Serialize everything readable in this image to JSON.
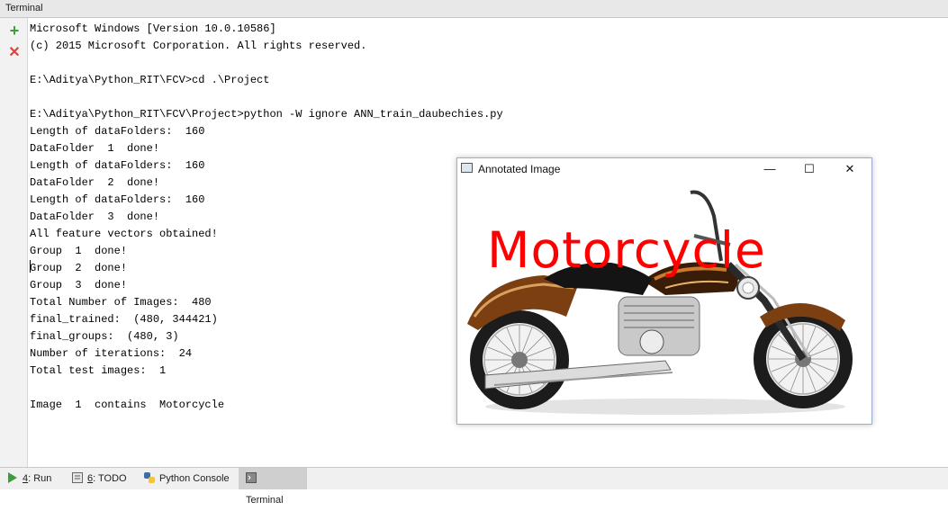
{
  "titlebar": {
    "title": "Terminal"
  },
  "gutter": {
    "add_icon": "plus-icon",
    "close_icon": "close-icon"
  },
  "console": {
    "lines": [
      "Microsoft Windows [Version 10.0.10586]",
      "(c) 2015 Microsoft Corporation. All rights reserved.",
      "",
      "E:\\Aditya\\Python_RIT\\FCV>cd .\\Project",
      "",
      "E:\\Aditya\\Python_RIT\\FCV\\Project>python -W ignore ANN_train_daubechies.py",
      "Length of dataFolders:  160",
      "DataFolder  1  done!",
      "Length of dataFolders:  160",
      "DataFolder  2  done!",
      "Length of dataFolders:  160",
      "DataFolder  3  done!",
      "All feature vectors obtained!",
      "Group  1  done!",
      "Group  2  done!",
      "Group  3  done!",
      "Total Number of Images:  480",
      "final_trained:  (480, 344421)",
      "final_groups:  (480, 3)",
      "Number of iterations:  24",
      "Total test images:  1",
      "",
      "Image  1  contains  Motorcycle"
    ]
  },
  "annotated_window": {
    "title": "Annotated Image",
    "minimize": "—",
    "maximize": "☐",
    "close": "✕",
    "annotation_text": "Motorcycle",
    "annotation_color": "#ff0000"
  },
  "bottom_tabs": [
    {
      "num": "4",
      "label": ": Run",
      "icon": "run-icon"
    },
    {
      "num": "6",
      "label": ": TODO",
      "icon": "todo-icon"
    },
    {
      "num": "",
      "label": "Python Console",
      "icon": "python-icon"
    },
    {
      "num": "",
      "label": "Terminal",
      "icon": "terminal-icon",
      "active": true
    }
  ]
}
